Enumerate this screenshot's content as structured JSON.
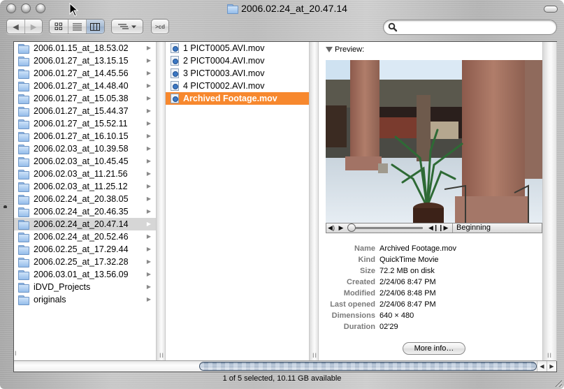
{
  "window": {
    "title": "2006.02.24_at_20.47.14",
    "title_icon": "folder-icon"
  },
  "toolbar": {
    "back_icon": "◀",
    "forward_icon": "▶",
    "view_icons": [
      "icon-view",
      "list-view",
      "column-view"
    ],
    "active_view": "column-view",
    "action_icon": "action-menu",
    "cd_label": ">cd",
    "search": {
      "value": "",
      "placeholder": ""
    }
  },
  "columns": {
    "folders": [
      {
        "name": "2006.01.15_at_18.53.02"
      },
      {
        "name": "2006.01.27_at_13.15.15"
      },
      {
        "name": "2006.01.27_at_14.45.56"
      },
      {
        "name": "2006.01.27_at_14.48.40"
      },
      {
        "name": "2006.01.27_at_15.05.38"
      },
      {
        "name": "2006.01.27_at_15.44.37"
      },
      {
        "name": "2006.01.27_at_15.52.11"
      },
      {
        "name": "2006.01.27_at_16.10.15"
      },
      {
        "name": "2006.02.03_at_10.39.58"
      },
      {
        "name": "2006.02.03_at_10.45.45"
      },
      {
        "name": "2006.02.03_at_11.21.56"
      },
      {
        "name": "2006.02.03_at_11.25.12"
      },
      {
        "name": "2006.02.24_at_20.38.05"
      },
      {
        "name": "2006.02.24_at_20.46.35"
      },
      {
        "name": "2006.02.24_at_20.47.14",
        "selected": true
      },
      {
        "name": "2006.02.24_at_20.52.46"
      },
      {
        "name": "2006.02.25_at_17.29.44"
      },
      {
        "name": "2006.02.25_at_17.32.28"
      },
      {
        "name": "2006.03.01_at_13.56.09"
      },
      {
        "name": "iDVD_Projects"
      },
      {
        "name": "originals"
      }
    ],
    "files": [
      {
        "name": "1 PICT0005.AVI.mov"
      },
      {
        "name": "2 PICT0004.AVI.mov"
      },
      {
        "name": "3 PICT0003.AVI.mov"
      },
      {
        "name": "4 PICT0002.AVI.mov"
      },
      {
        "name": "Archived Footage.mov",
        "selected": true
      }
    ]
  },
  "preview": {
    "label": "Preview:",
    "controller": {
      "time_label": "Beginning",
      "playhead_fraction": 0
    },
    "info": [
      {
        "key": "Name",
        "value": "Archived Footage.mov"
      },
      {
        "key": "Kind",
        "value": "QuickTime Movie"
      },
      {
        "key": "Size",
        "value": "72.2 MB on disk"
      },
      {
        "key": "Created",
        "value": "2/24/06 8:47 PM"
      },
      {
        "key": "Modified",
        "value": "2/24/06 8:48 PM"
      },
      {
        "key": "Last opened",
        "value": "2/24/06 8:47 PM"
      },
      {
        "key": "Dimensions",
        "value": "640 × 480"
      },
      {
        "key": "Duration",
        "value": "02'29"
      }
    ],
    "more_info_label": "More info…"
  },
  "status": {
    "text": "1 of 5 selected, 10.11 GB available"
  },
  "colors": {
    "selection_active": "#f7882e",
    "selection_inactive": "#d6d6d6",
    "info_key": "#7b7b7b"
  }
}
